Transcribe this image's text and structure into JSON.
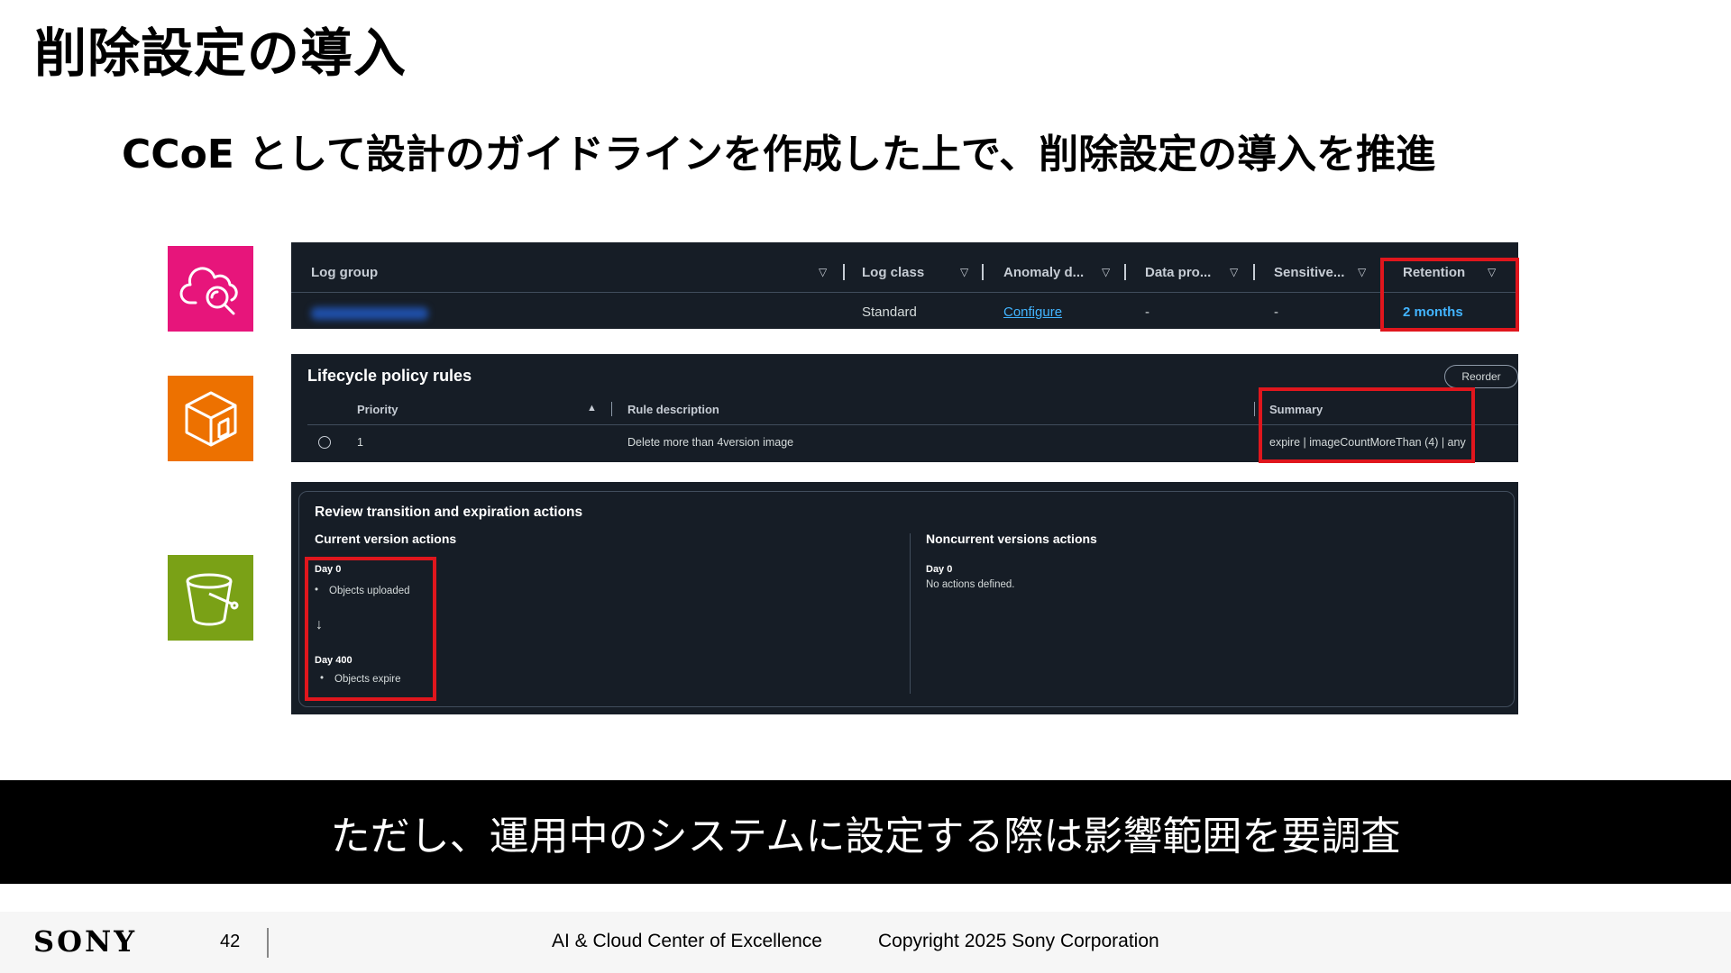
{
  "slide": {
    "title": "削除設定の導入",
    "subtitle": "CCoE として設計のガイドラインを作成した上で、削除設定の導入を推進"
  },
  "icons": [
    {
      "name": "cloudwatch-logs-icon",
      "color": "#e7157b"
    },
    {
      "name": "ecr-lifecycle-icon",
      "color": "#ed7100"
    },
    {
      "name": "s3-bucket-icon",
      "color": "#7aa116"
    }
  ],
  "log_groups": {
    "headers": [
      "Log group",
      "Log class",
      "Anomaly d...",
      "Data pro...",
      "Sensitive...",
      "Retention"
    ],
    "row": {
      "log_class": "Standard",
      "anomaly": "Configure",
      "data_protection": "-",
      "sensitive": "-",
      "retention": "2 months"
    }
  },
  "lifecycle": {
    "title": "Lifecycle policy rules",
    "reorder": "Reorder",
    "headers": [
      "Priority",
      "Rule description",
      "Summary"
    ],
    "row": {
      "priority": "1",
      "description": "Delete more than 4version image",
      "summary": "expire | imageCountMoreThan (4) | any"
    }
  },
  "review": {
    "title": "Review transition and expiration actions",
    "current_title": "Current version actions",
    "current": {
      "day0": "Day 0",
      "day0_item": "Objects uploaded",
      "arrow": "↓",
      "day400": "Day 400",
      "day400_item": "Objects expire"
    },
    "noncurrent_title": "Noncurrent versions actions",
    "noncurrent": {
      "day0": "Day 0",
      "text": "No actions defined."
    }
  },
  "banner": "ただし、運用中のシステムに設定する際は影響範囲を要調査",
  "footer": {
    "brand": "SONY",
    "page": "42",
    "org": "AI & Cloud Center of Excellence",
    "copyright": "Copyright 2025 Sony Corporation"
  }
}
